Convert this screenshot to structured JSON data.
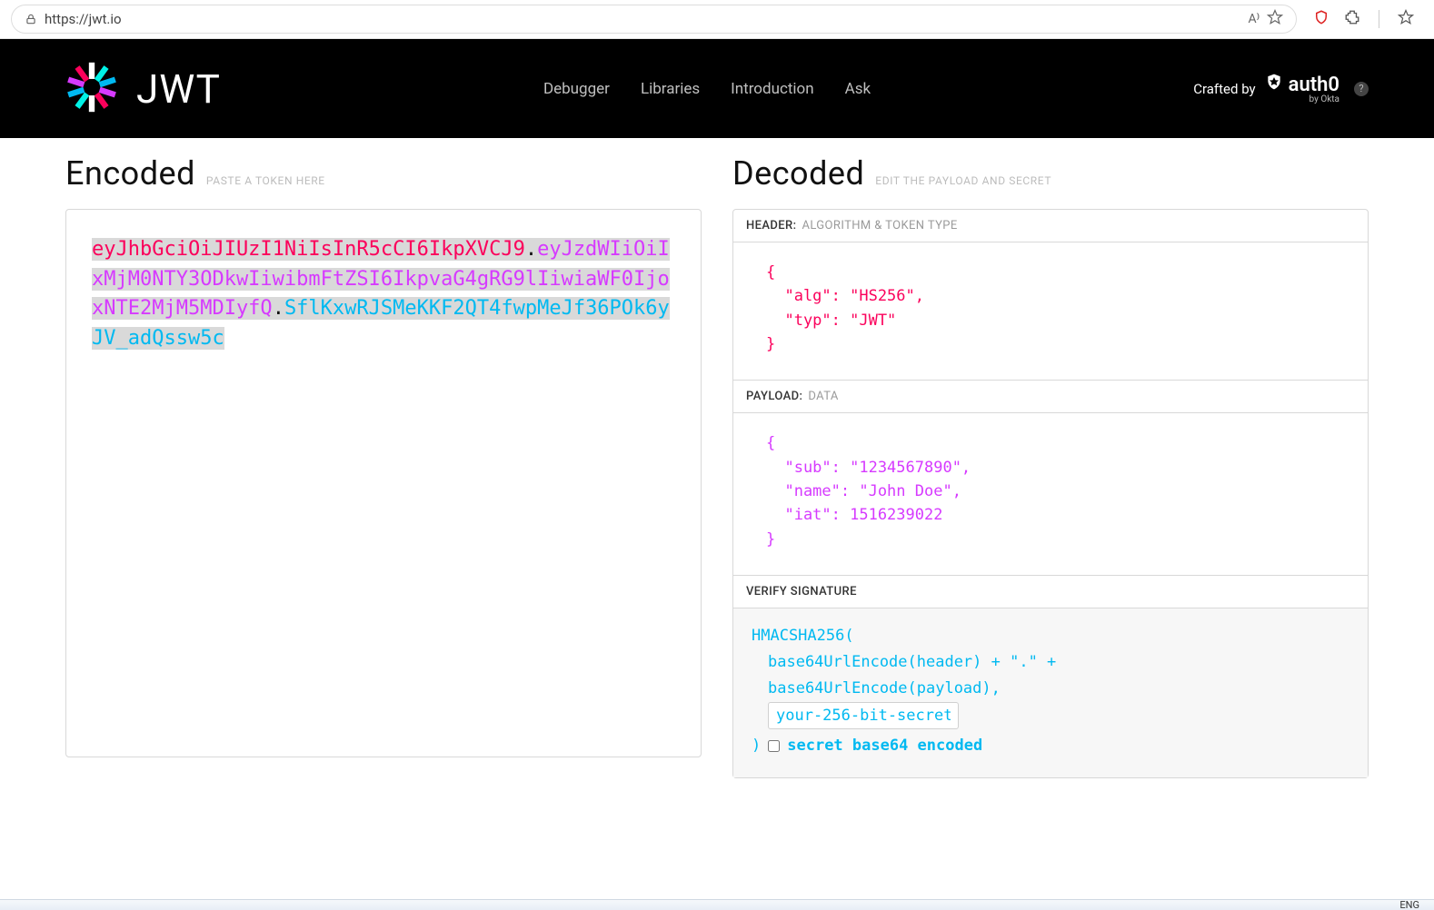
{
  "browser": {
    "url": "https://jwt.io",
    "lang_indicator": "ENG"
  },
  "header": {
    "brand_text": "JWT",
    "nav": [
      "Debugger",
      "Libraries",
      "Introduction",
      "Ask"
    ],
    "crafted_by": "Crafted by",
    "auth0": "auth0",
    "by_okta": "by Okta"
  },
  "encoded": {
    "title": "Encoded",
    "subtitle": "PASTE A TOKEN HERE",
    "token_header": "eyJhbGciOiJIUzI1NiIsInR5cCI6IkpXVCJ9",
    "token_payload": "eyJzdWIiOiIxMjM0NTY3ODkwIiwibmFtZSI6IkpvaG4gRG9lIiwiaWF0IjoxNTE2MjM5MDIyfQ",
    "token_sig": "SflKxwRJSMeKKF2QT4fwpMeJf36POk6yJV_adQssw5c"
  },
  "decoded": {
    "title": "Decoded",
    "subtitle": "EDIT THE PAYLOAD AND SECRET",
    "header_section": {
      "label": "HEADER:",
      "sub": "ALGORITHM & TOKEN TYPE",
      "json": "{\n  \"alg\": \"HS256\",\n  \"typ\": \"JWT\"\n}"
    },
    "payload_section": {
      "label": "PAYLOAD:",
      "sub": "DATA",
      "json": "{\n  \"sub\": \"1234567890\",\n  \"name\": \"John Doe\",\n  \"iat\": 1516239022\n}"
    },
    "signature_section": {
      "label": "VERIFY SIGNATURE",
      "algo_open": "HMACSHA256(",
      "line_header": "base64UrlEncode(header) + \".\" +",
      "line_payload": "base64UrlEncode(payload),",
      "secret_value": "your-256-bit-secret",
      "close_paren": ")",
      "checkbox_label": "secret base64 encoded"
    }
  }
}
